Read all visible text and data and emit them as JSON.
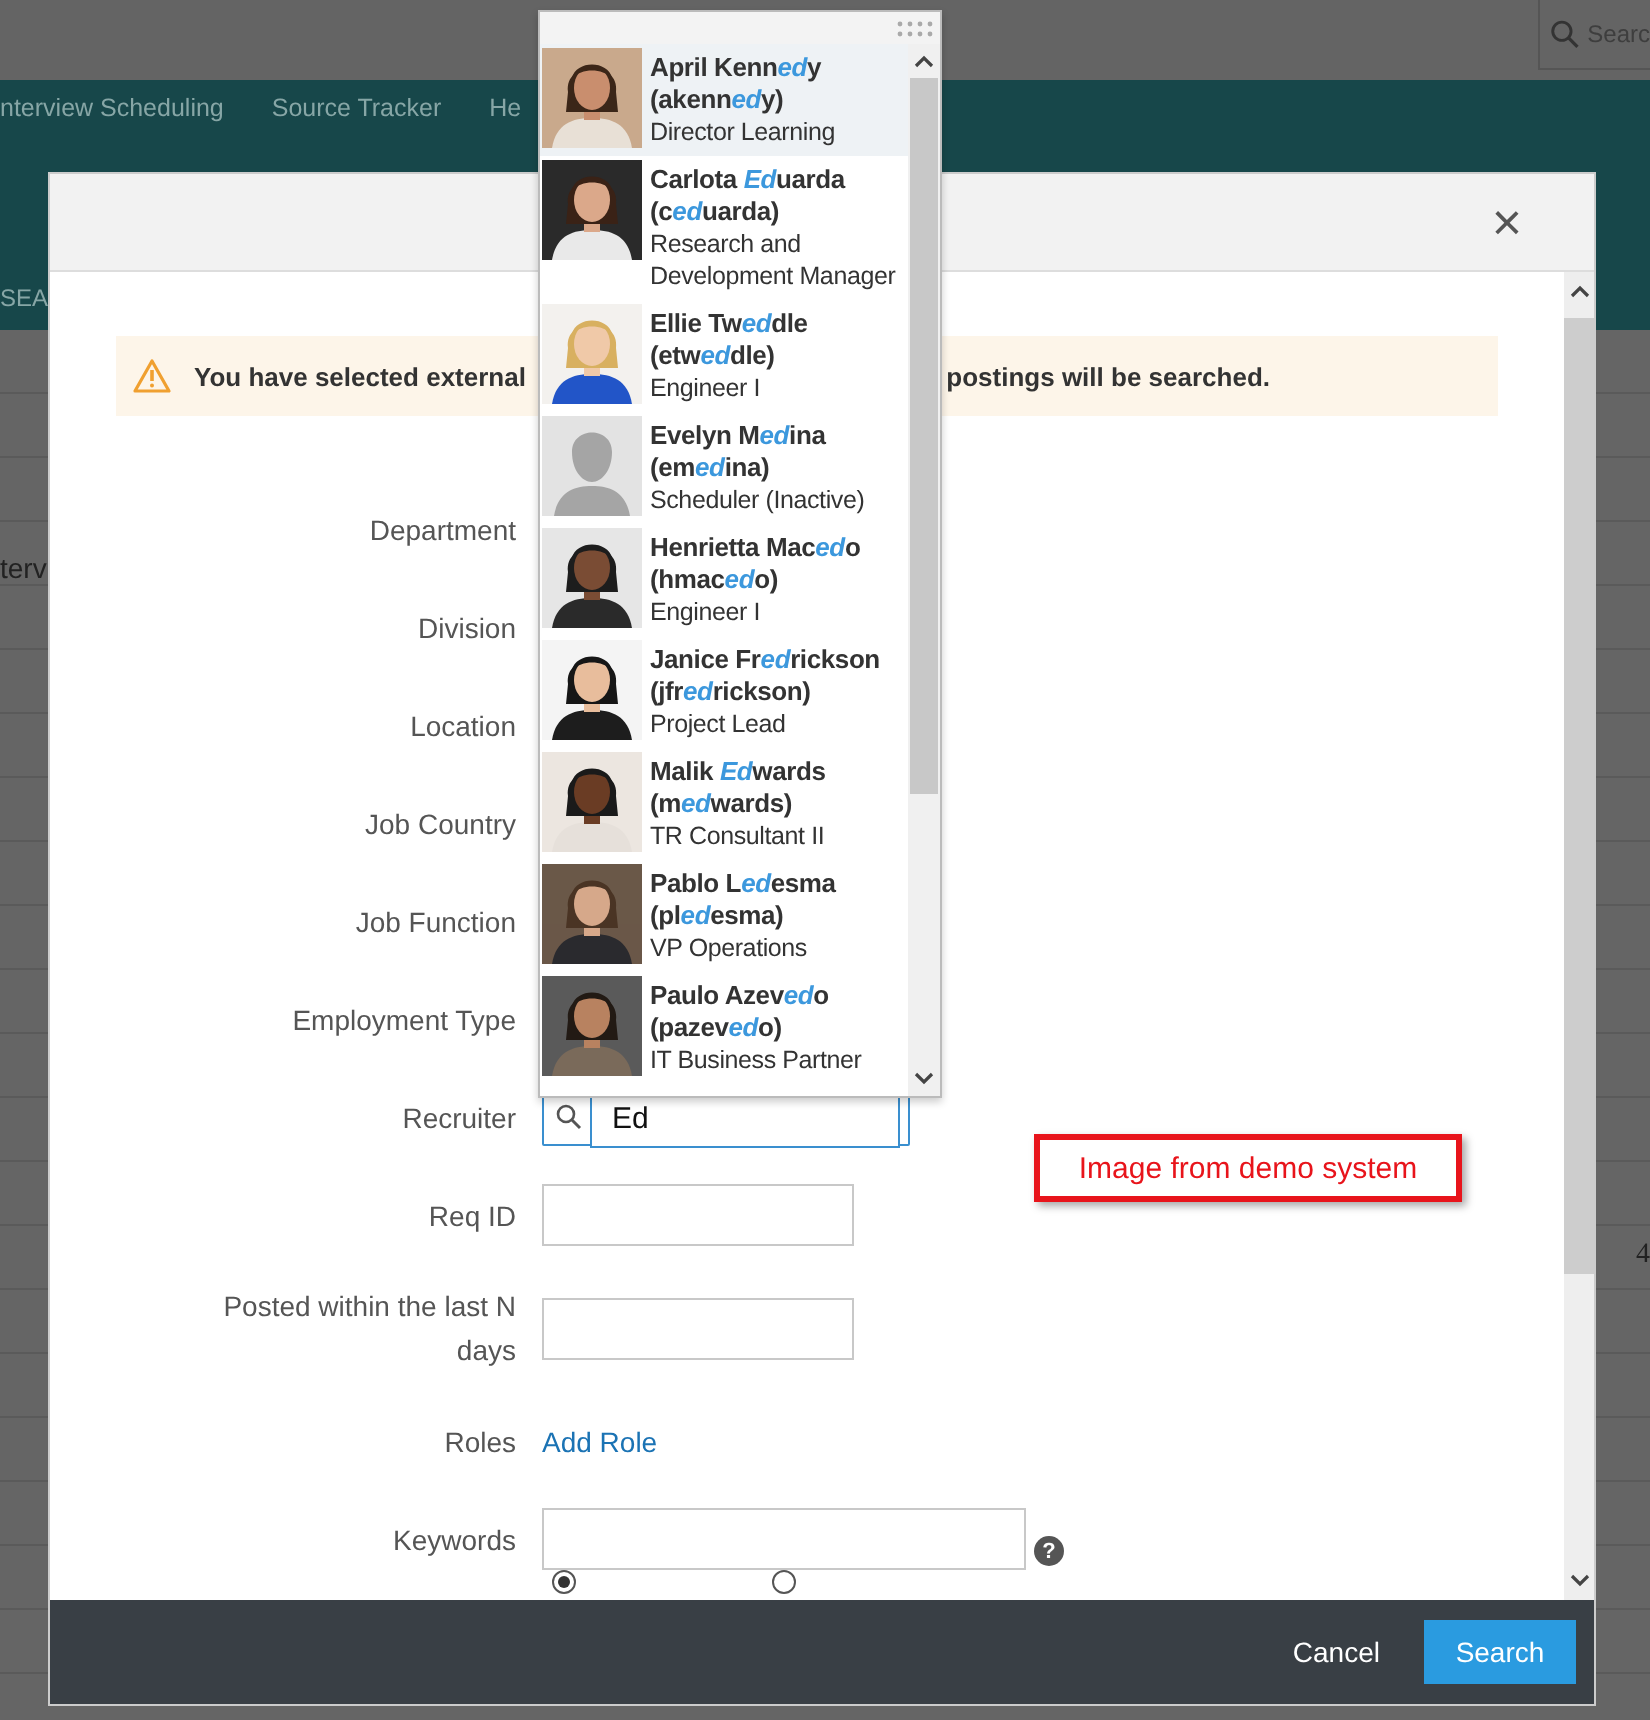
{
  "app_bar": {
    "search": {
      "placeholder": "Searc"
    }
  },
  "nav": {
    "items": [
      "nterview Scheduling",
      "Source Tracker",
      "He"
    ],
    "section": "SEA"
  },
  "background": {
    "row_text": "terv",
    "cell_text": "4"
  },
  "modal": {
    "close": "×",
    "warning": {
      "parts": [
        "You have selected external",
        "postings will be searched."
      ]
    },
    "fields": [
      {
        "label": "Department",
        "kind": "covered"
      },
      {
        "label": "Division",
        "kind": "covered"
      },
      {
        "label": "Location",
        "kind": "covered"
      },
      {
        "label": "Job Country",
        "kind": "covered"
      },
      {
        "label": "Job Function",
        "kind": "covered"
      },
      {
        "label": "Employment Type",
        "kind": "covered"
      },
      {
        "label": "Recruiter",
        "kind": "lookup",
        "value": "Ed"
      },
      {
        "label": "Req ID",
        "kind": "text"
      },
      {
        "label": "Posted within the last N days",
        "kind": "text"
      },
      {
        "label": "Roles",
        "kind": "link",
        "link": "Add Role"
      },
      {
        "label": "Keywords",
        "kind": "keywords",
        "help": "?"
      }
    ],
    "scope_radios": [
      {
        "selected": true
      },
      {
        "selected": false
      }
    ],
    "buttons": {
      "cancel": "Cancel",
      "search": "Search"
    }
  },
  "dropdown": {
    "items": [
      {
        "name": [
          {
            "text": "April Kenn",
            "match": false
          },
          {
            "text": "ed",
            "match": true
          },
          {
            "text": "y",
            "match": false
          }
        ],
        "login": [
          {
            "text": "(akenn",
            "match": false
          },
          {
            "text": "ed",
            "match": true
          },
          {
            "text": "y)",
            "match": false
          }
        ],
        "title": "Director Learning",
        "selected": true
      },
      {
        "name": [
          {
            "text": "Carlota ",
            "match": false
          },
          {
            "text": "Ed",
            "match": true
          },
          {
            "text": "uarda",
            "match": false
          }
        ],
        "login": [
          {
            "text": "(c",
            "match": false
          },
          {
            "text": "ed",
            "match": true
          },
          {
            "text": "uarda)",
            "match": false
          }
        ],
        "title": "Research and Development Manager",
        "selected": false
      },
      {
        "name": [
          {
            "text": "Ellie Tw",
            "match": false
          },
          {
            "text": "ed",
            "match": true
          },
          {
            "text": "dle",
            "match": false
          }
        ],
        "login": [
          {
            "text": "(etw",
            "match": false
          },
          {
            "text": "ed",
            "match": true
          },
          {
            "text": "dle)",
            "match": false
          }
        ],
        "title": "Engineer I",
        "selected": false
      },
      {
        "name": [
          {
            "text": "Evelyn M",
            "match": false
          },
          {
            "text": "ed",
            "match": true
          },
          {
            "text": "ina",
            "match": false
          }
        ],
        "login": [
          {
            "text": "(em",
            "match": false
          },
          {
            "text": "ed",
            "match": true
          },
          {
            "text": "ina)",
            "match": false
          }
        ],
        "title": "Scheduler (Inactive)",
        "kind": "placeholder",
        "selected": false
      },
      {
        "name": [
          {
            "text": "Henrietta Mac",
            "match": false
          },
          {
            "text": "ed",
            "match": true
          },
          {
            "text": "o",
            "match": false
          }
        ],
        "login": [
          {
            "text": "(hmac",
            "match": false
          },
          {
            "text": "ed",
            "match": true
          },
          {
            "text": "o)",
            "match": false
          }
        ],
        "title": "Engineer I",
        "selected": false
      },
      {
        "name": [
          {
            "text": "Janice Fr",
            "match": false
          },
          {
            "text": "ed",
            "match": true
          },
          {
            "text": "rickson",
            "match": false
          }
        ],
        "login": [
          {
            "text": "(jfr",
            "match": false
          },
          {
            "text": "ed",
            "match": true
          },
          {
            "text": "rickson)",
            "match": false
          }
        ],
        "title": "Project Lead",
        "selected": false
      },
      {
        "name": [
          {
            "text": "Malik ",
            "match": false
          },
          {
            "text": "Ed",
            "match": true
          },
          {
            "text": "wards",
            "match": false
          }
        ],
        "login": [
          {
            "text": "(m",
            "match": false
          },
          {
            "text": "ed",
            "match": true
          },
          {
            "text": "wards)",
            "match": false
          }
        ],
        "title": "TR Consultant II",
        "selected": false
      },
      {
        "name": [
          {
            "text": "Pablo L",
            "match": false
          },
          {
            "text": "ed",
            "match": true
          },
          {
            "text": "esma",
            "match": false
          }
        ],
        "login": [
          {
            "text": "(pl",
            "match": false
          },
          {
            "text": "ed",
            "match": true
          },
          {
            "text": "esma)",
            "match": false
          }
        ],
        "title": "VP Operations",
        "selected": false
      },
      {
        "name": [
          {
            "text": "Paulo Azev",
            "match": false
          },
          {
            "text": "ed",
            "match": true
          },
          {
            "text": "o",
            "match": false
          }
        ],
        "login": [
          {
            "text": "(pazev",
            "match": false
          },
          {
            "text": "ed",
            "match": true
          },
          {
            "text": "o)",
            "match": false
          }
        ],
        "title": "IT Business Partner",
        "selected": false
      }
    ]
  },
  "annotation": "Image from demo system"
}
